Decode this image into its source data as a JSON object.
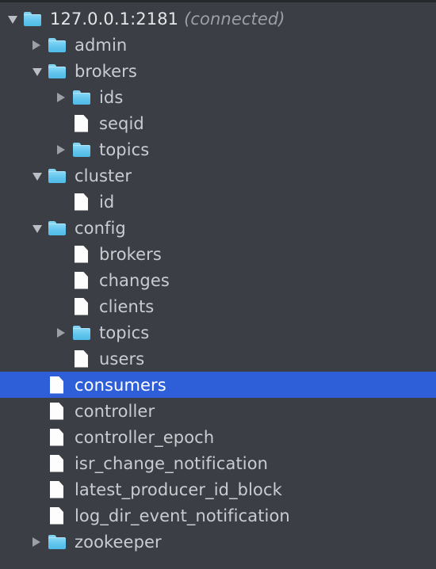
{
  "panel": {
    "background_color": "#3b3e44",
    "selection_color": "#2f5fd8",
    "folder_color": "#62c4ec",
    "file_color": "#fdfdfd",
    "text_color": "#c9cdd2"
  },
  "tree": {
    "root": {
      "label": "127.0.0.1:2181",
      "status": "(connected)",
      "icon": "folder-icon",
      "expander": "chevron-down-icon",
      "depth": 0,
      "selected": false
    },
    "nodes": [
      {
        "label": "admin",
        "type": "folder",
        "expander": "chevron-right-icon",
        "depth": 1,
        "selected": false
      },
      {
        "label": "brokers",
        "type": "folder",
        "expander": "chevron-down-icon",
        "depth": 1,
        "selected": false
      },
      {
        "label": "ids",
        "type": "folder",
        "expander": "chevron-right-icon",
        "depth": 2,
        "selected": false
      },
      {
        "label": "seqid",
        "type": "file",
        "expander": "none",
        "depth": 2,
        "selected": false
      },
      {
        "label": "topics",
        "type": "folder",
        "expander": "chevron-right-icon",
        "depth": 2,
        "selected": false
      },
      {
        "label": "cluster",
        "type": "folder",
        "expander": "chevron-down-icon",
        "depth": 1,
        "selected": false
      },
      {
        "label": "id",
        "type": "file",
        "expander": "none",
        "depth": 2,
        "selected": false
      },
      {
        "label": "config",
        "type": "folder",
        "expander": "chevron-down-icon",
        "depth": 1,
        "selected": false
      },
      {
        "label": "brokers",
        "type": "file",
        "expander": "none",
        "depth": 2,
        "selected": false
      },
      {
        "label": "changes",
        "type": "file",
        "expander": "none",
        "depth": 2,
        "selected": false
      },
      {
        "label": "clients",
        "type": "file",
        "expander": "none",
        "depth": 2,
        "selected": false
      },
      {
        "label": "topics",
        "type": "folder",
        "expander": "chevron-right-icon",
        "depth": 2,
        "selected": false
      },
      {
        "label": "users",
        "type": "file",
        "expander": "none",
        "depth": 2,
        "selected": false
      },
      {
        "label": "consumers",
        "type": "file",
        "expander": "none",
        "depth": 1,
        "selected": true
      },
      {
        "label": "controller",
        "type": "file",
        "expander": "none",
        "depth": 1,
        "selected": false
      },
      {
        "label": "controller_epoch",
        "type": "file",
        "expander": "none",
        "depth": 1,
        "selected": false
      },
      {
        "label": "isr_change_notification",
        "type": "file",
        "expander": "none",
        "depth": 1,
        "selected": false
      },
      {
        "label": "latest_producer_id_block",
        "type": "file",
        "expander": "none",
        "depth": 1,
        "selected": false
      },
      {
        "label": "log_dir_event_notification",
        "type": "file",
        "expander": "none",
        "depth": 1,
        "selected": false
      },
      {
        "label": "zookeeper",
        "type": "folder",
        "expander": "chevron-right-icon",
        "depth": 1,
        "selected": false
      }
    ]
  }
}
